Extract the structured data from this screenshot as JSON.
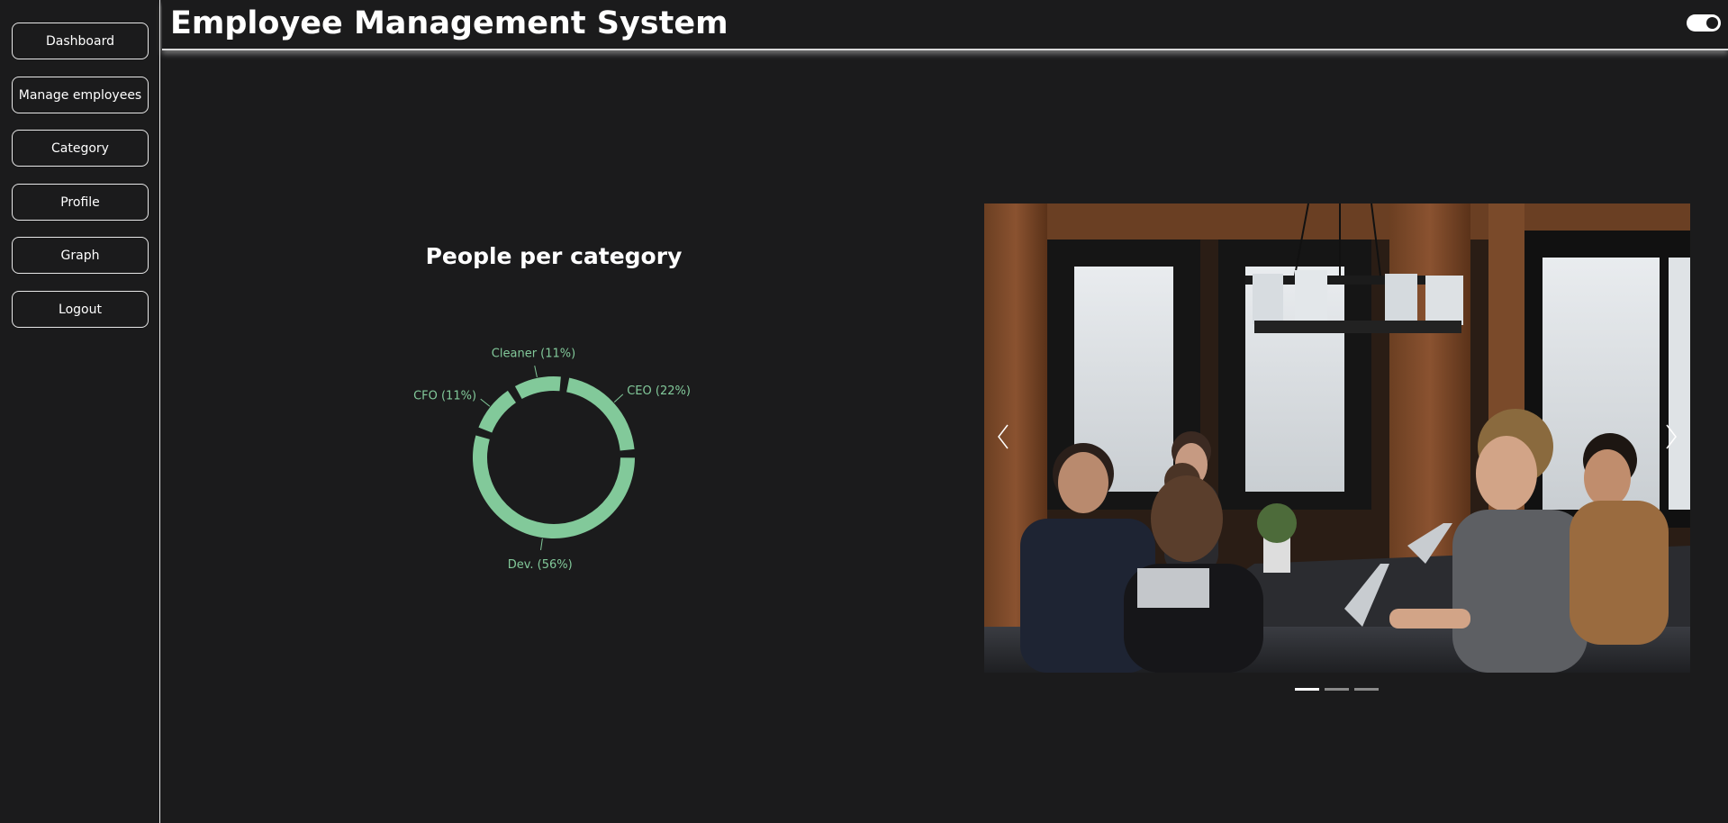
{
  "app": {
    "title": "Employee Management System"
  },
  "sidebar": {
    "items": [
      {
        "label": "Dashboard"
      },
      {
        "label": "Manage employees"
      },
      {
        "label": "Category"
      },
      {
        "label": "Profile"
      },
      {
        "label": "Graph"
      },
      {
        "label": "Logout"
      }
    ]
  },
  "header": {
    "theme_toggle": {
      "on": true,
      "icon": "toggle-switch-icon"
    }
  },
  "chart_data": {
    "type": "pie",
    "title": "People per category",
    "slices": [
      {
        "label": "CEO (22%)",
        "name": "CEO",
        "value": 22
      },
      {
        "label": "Dev. (56%)",
        "name": "Dev.",
        "value": 56
      },
      {
        "label": "CFO (11%)",
        "name": "CFO",
        "value": 11
      },
      {
        "label": "Cleaner (11%)",
        "name": "Cleaner",
        "value": 11
      }
    ],
    "style": "donut",
    "color": "#82c99a"
  },
  "carousel": {
    "slide_count": 3,
    "active_index": 0,
    "prev_icon": "chevron-left-icon",
    "next_icon": "chevron-right-icon"
  },
  "colors": {
    "background": "#1b1b1c",
    "accent": "#82c99a",
    "text": "#ffffff"
  }
}
